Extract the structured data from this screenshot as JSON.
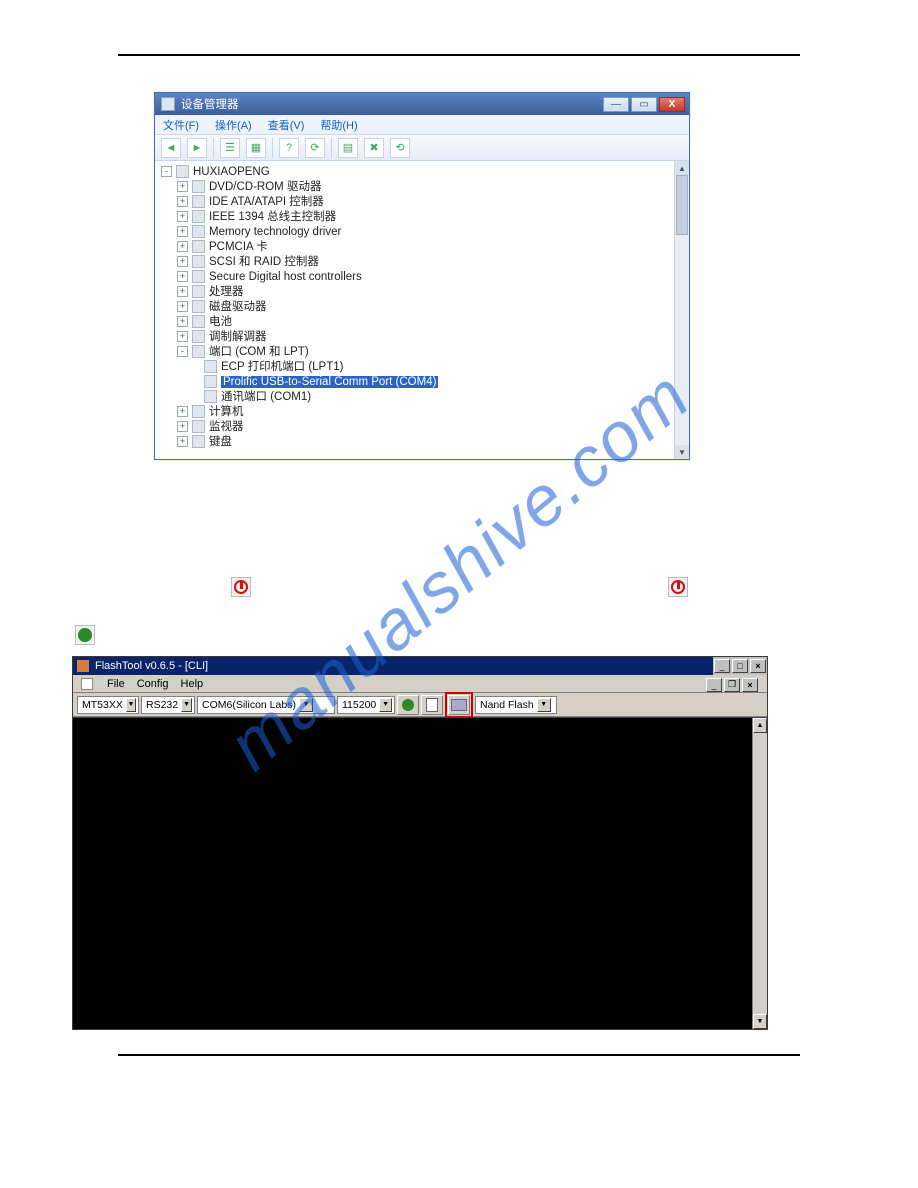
{
  "devmgr": {
    "title": "设备管理器",
    "menu": {
      "file": "文件(F)",
      "action": "操作(A)",
      "view": "查看(V)",
      "help": "帮助(H)"
    },
    "root": "HUXIAOPENG",
    "nodes": [
      {
        "label": "DVD/CD-ROM 驱动器"
      },
      {
        "label": "IDE ATA/ATAPI 控制器"
      },
      {
        "label": "IEEE 1394 总线主控制器"
      },
      {
        "label": "Memory technology driver"
      },
      {
        "label": "PCMCIA 卡"
      },
      {
        "label": "SCSI 和 RAID 控制器"
      },
      {
        "label": "Secure Digital host controllers"
      },
      {
        "label": "处理器"
      },
      {
        "label": "磁盘驱动器"
      },
      {
        "label": "电池"
      },
      {
        "label": "调制解调器"
      }
    ],
    "ports_label": "端口 (COM 和 LPT)",
    "port_children": {
      "ecp": "ECP 打印机端口 (LPT1)",
      "prolific": "Prolific USB-to-Serial Comm Port (COM4)",
      "com1": "通讯端口 (COM1)"
    },
    "tail": [
      {
        "label": "计算机"
      },
      {
        "label": "监视器"
      },
      {
        "label": "键盘"
      }
    ]
  },
  "flashtool": {
    "title": "FlashTool v0.6.5 - [CLI]",
    "menu": {
      "file": "File",
      "config": "Config",
      "help": "Help"
    },
    "combos": {
      "chip": "MT53XX",
      "link": "RS232",
      "port": "COM6(Silicon Labs)",
      "baud": "115200",
      "flash": "Nand Flash"
    }
  }
}
